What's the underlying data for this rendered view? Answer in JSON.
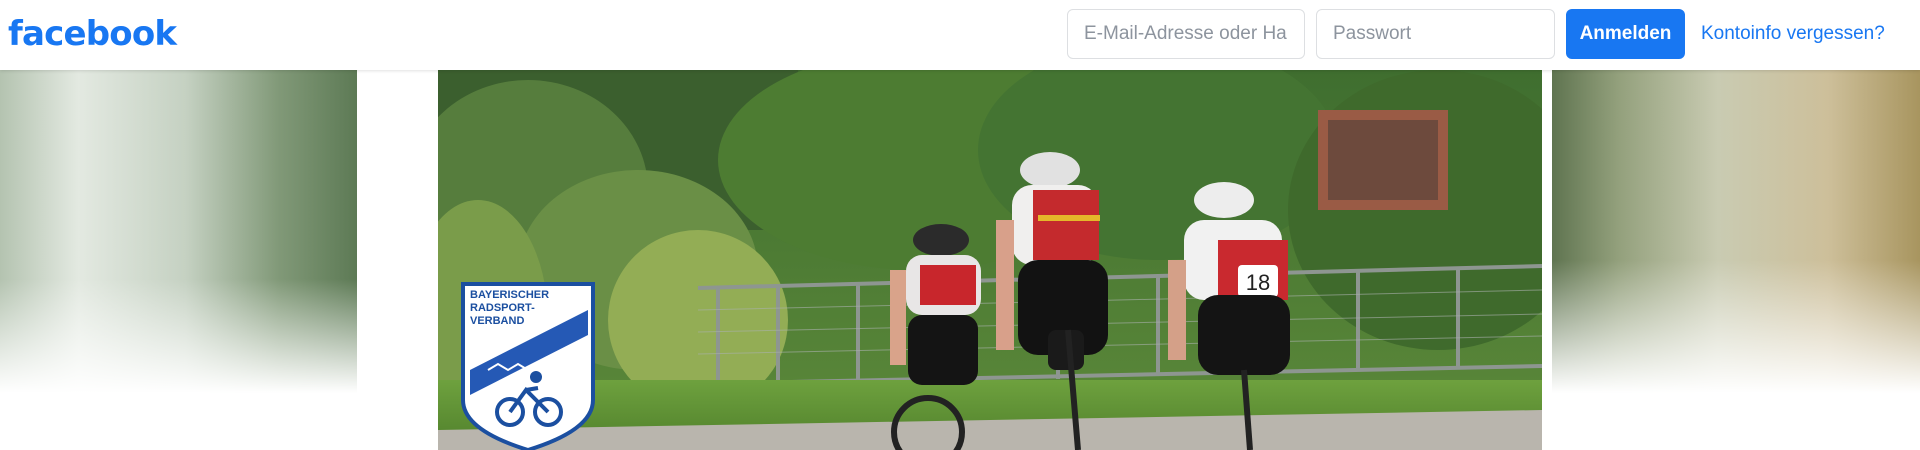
{
  "header": {
    "logo_text": "facebook",
    "email_placeholder": "E-Mail-Adresse oder Handynummer",
    "password_placeholder": "Passwort",
    "login_label": "Anmelden",
    "forgot_label": "Kontoinfo vergessen?"
  },
  "cover": {
    "logo_lines": [
      "BAYERISCHER",
      "RADSPORT-",
      "VERBAND"
    ],
    "bib_number": "18"
  },
  "colors": {
    "brand_blue": "#1877f2",
    "placeholder_gray": "#8d949e"
  }
}
